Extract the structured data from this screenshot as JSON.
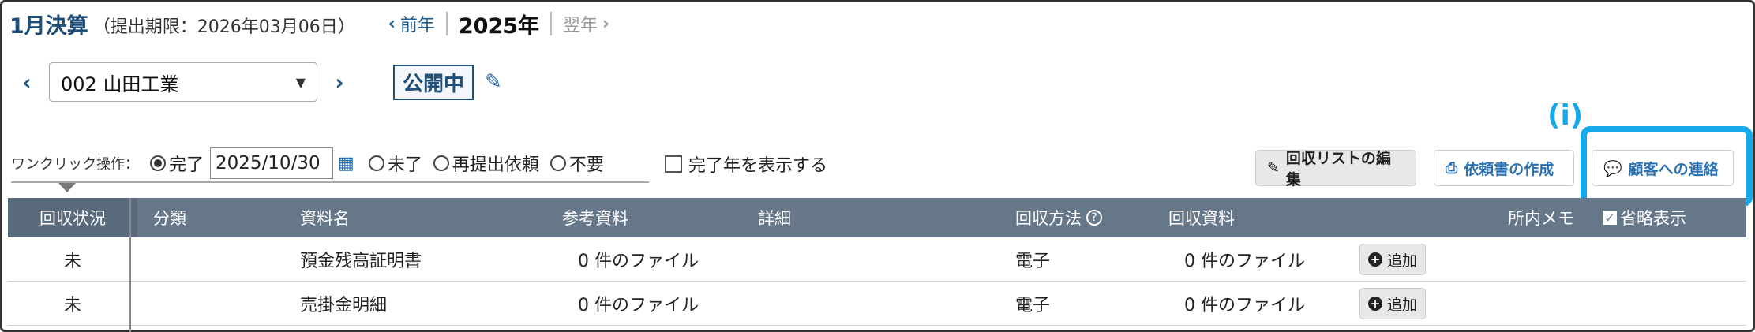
{
  "header": {
    "title": "1月決算",
    "deadline": "（提出期限：2026年03月06日）",
    "prev_year": "前年",
    "current_year": "2025年",
    "next_year": "翌年"
  },
  "client": {
    "selected": "002 山田工業",
    "status": "公開中"
  },
  "one_click": {
    "label": "ワンクリック操作：",
    "options": [
      "完了",
      "未了",
      "再提出依頼",
      "不要"
    ],
    "selected": "完了",
    "date": "2025/10/30",
    "show_completed_label": "完了年を表示する"
  },
  "actions": {
    "edit_list": "回収リストの編集",
    "create_request": "依頼書の作成",
    "contact_client": "顧客への連絡",
    "info_marker": "(i)"
  },
  "table": {
    "headers": [
      "回収状況",
      "分類",
      "資料名",
      "参考資料",
      "詳細",
      "回収方法",
      "回収資料",
      "所内メモ",
      "省略表示"
    ],
    "rows": [
      {
        "status": "未",
        "category": "",
        "name": "預金残高証明書",
        "reference": "0 件のファイル",
        "detail": "",
        "method": "電子",
        "collected": "0 件のファイル",
        "add": "追加"
      },
      {
        "status": "未",
        "category": "",
        "name": "売掛金明細",
        "reference": "0 件のファイル",
        "detail": "",
        "method": "電子",
        "collected": "0 件のファイル",
        "add": "追加"
      }
    ]
  },
  "colors": {
    "accent": "#1f4e79",
    "header_bg": "#667789",
    "highlight": "#15a9e9"
  }
}
